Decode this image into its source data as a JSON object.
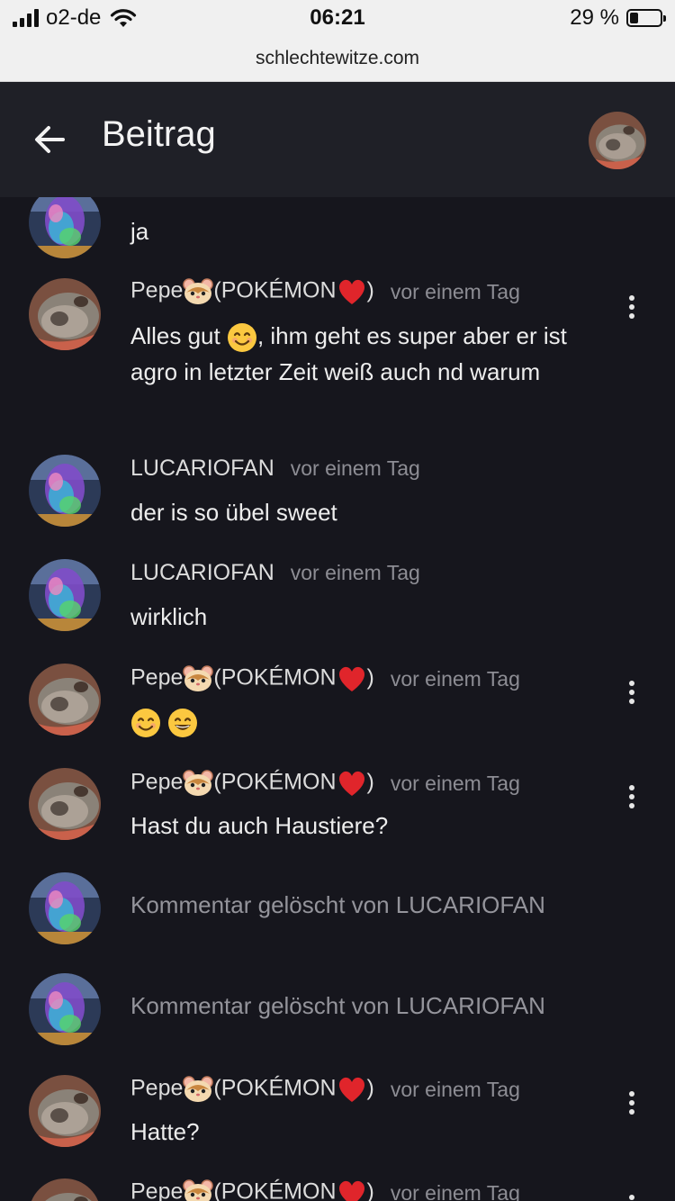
{
  "status_bar": {
    "carrier": "o2-de",
    "time": "06:21",
    "battery": "29 %",
    "battery_level": 0.29
  },
  "url": "schlechtewitze.com",
  "header": {
    "title": "Beitrag",
    "back_icon": "arrow-left-icon",
    "avatar_icon": "user-avatar"
  },
  "icons": {
    "more": "vertical-dots-icon",
    "hamster": "hamster-emoji",
    "heart": "red-heart-emoji",
    "smile": "smiling-face-emoji",
    "grin": "grinning-face-emoji"
  },
  "comments": [
    {
      "type": "partial",
      "avatar": "lucario",
      "text": "ja"
    },
    {
      "type": "comment",
      "avatar": "pepe",
      "author": "Pepe",
      "author_suffix": "(POKÉMON",
      "author_close": ")",
      "time": "vor einem Tag",
      "text_before": "Alles gut ",
      "text_after": ", ihm geht es super aber er ist agro in letzter Zeit weiß auch nd warum",
      "more": true
    },
    {
      "type": "comment",
      "avatar": "lucario",
      "author": "LUCARIOFAN",
      "time": "vor einem Tag",
      "text": "der is so übel sweet",
      "more": false
    },
    {
      "type": "comment",
      "avatar": "lucario",
      "author": "LUCARIOFAN",
      "time": "vor einem Tag",
      "text": "wirklich",
      "more": false
    },
    {
      "type": "comment",
      "avatar": "pepe",
      "author": "Pepe",
      "author_suffix": "(POKÉMON",
      "author_close": ")",
      "time": "vor einem Tag",
      "text": "",
      "more": true
    },
    {
      "type": "comment",
      "avatar": "pepe",
      "author": "Pepe",
      "author_suffix": "(POKÉMON",
      "author_close": ")",
      "time": "vor einem Tag",
      "text": "Hast du auch Haustiere?",
      "more": true
    },
    {
      "type": "deleted",
      "avatar": "lucario",
      "text": "Kommentar gelöscht von LUCARIOFAN"
    },
    {
      "type": "deleted",
      "avatar": "lucario",
      "text": "Kommentar gelöscht von LUCARIOFAN"
    },
    {
      "type": "comment",
      "avatar": "pepe",
      "author": "Pepe",
      "author_suffix": "(POKÉMON",
      "author_close": ")",
      "time": "vor einem Tag",
      "text": "Hatte?",
      "more": true
    },
    {
      "type": "comment",
      "avatar": "pepe",
      "author": "Pepe",
      "author_suffix": "(POKÉMON",
      "author_close": ")",
      "time": "vor einem Tag",
      "text": "",
      "more": true
    }
  ]
}
